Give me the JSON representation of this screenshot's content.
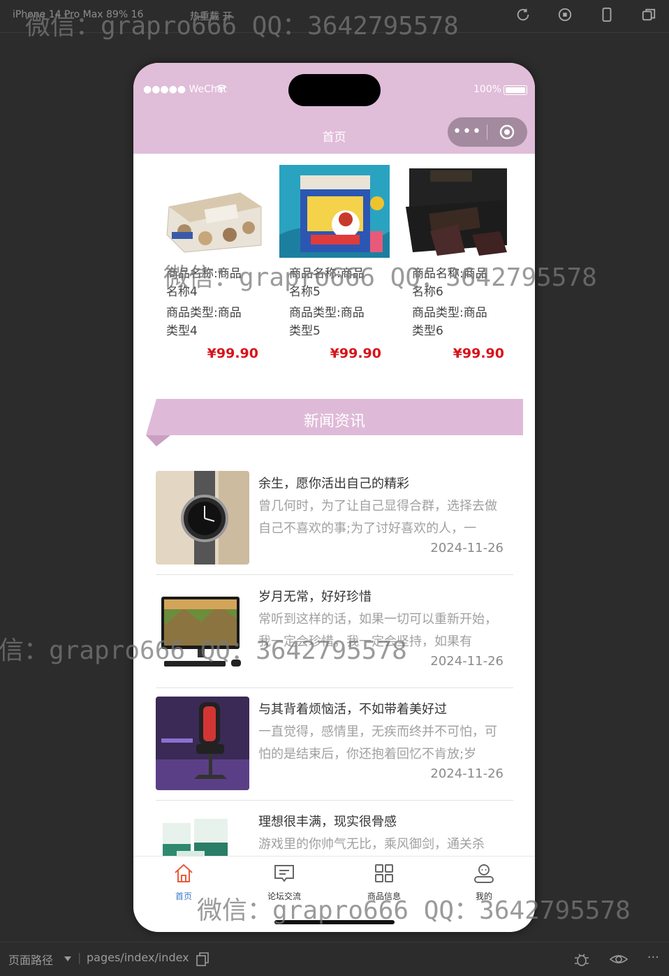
{
  "devtools": {
    "device": "iPhone 14 Pro Max 89% 16",
    "hot_reload": "热重载 开",
    "path_label": "页面路径",
    "path": "pages/index/index"
  },
  "status": {
    "carrier": "●●●●● WeChat",
    "battery": "100%"
  },
  "nav": {
    "title": "首页",
    "more": "•••"
  },
  "products": [
    {
      "name": "商品名称:商品名称4",
      "type": "商品类型:商品类型4",
      "price": "¥99.90",
      "image": "chocolate-box"
    },
    {
      "name": "商品名称:商品名称5",
      "type": "商品类型:商品类型5",
      "price": "¥99.90",
      "image": "candy-tin"
    },
    {
      "name": "商品名称:商品名称6",
      "type": "商品类型:商品类型6",
      "price": "¥99.90",
      "image": "dark-chocolate"
    }
  ],
  "news_section_title": "新闻资讯",
  "news": [
    {
      "title": "余生，愿你活出自己的精彩",
      "desc": "曾几何时，为了让自己显得合群，选择去做自己不喜欢的事;为了讨好喜欢的人，一",
      "date": "2024-11-26",
      "image": "watch"
    },
    {
      "title": "岁月无常，好好珍惜",
      "desc": "常听到这样的话，如果一切可以重新开始，我一定会珍惜，我一定会坚持，如果有",
      "date": "2024-11-26",
      "image": "computer"
    },
    {
      "title": "与其背着烦恼活，不如带着美好过",
      "desc": "一直觉得，感情里，无疾而终并不可怕，可怕的是结束后，你还抱着回忆不肯放;岁",
      "date": "2024-11-26",
      "image": "gaming-chair"
    },
    {
      "title": "理想很丰满，现实很骨感",
      "desc": "游戏里的你帅气无比，乘风御剑，通关杀",
      "date": "",
      "image": "boxes"
    }
  ],
  "tabs": [
    {
      "label": "首页",
      "icon": "home-icon",
      "active": true
    },
    {
      "label": "论坛交流",
      "icon": "forum-icon",
      "active": false
    },
    {
      "label": "商品信息",
      "icon": "grid-icon",
      "active": false
    },
    {
      "label": "我的",
      "icon": "user-icon",
      "active": false
    }
  ],
  "watermark": "微信：grapro666 QQ：3642795578",
  "colors": {
    "theme": "#e0bdd9",
    "price": "#d8131b",
    "tab_active": "#e85a3c"
  }
}
